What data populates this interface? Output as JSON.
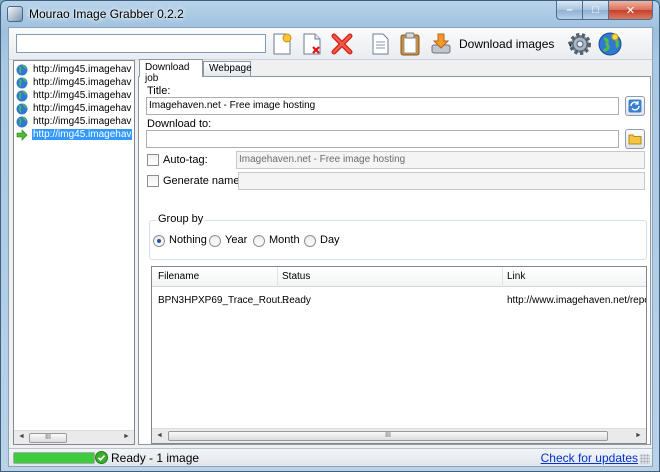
{
  "window": {
    "title": "Mourao Image Grabber 0.2.2",
    "min_glyph": "–",
    "max_glyph": "□",
    "close_glyph": "✕"
  },
  "toolbar": {
    "url_value": "",
    "download_label": "Download images",
    "download_arrow": "▼",
    "icons": [
      "new-job-icon",
      "remove-job-icon",
      "delete-icon",
      "document-icon",
      "clipboard-icon",
      "download-images-icon",
      "settings-gear-icon",
      "globe-icon"
    ]
  },
  "tree": {
    "items": [
      {
        "label": "http://img45.imagehav",
        "icon": "globe-icon",
        "selected": false
      },
      {
        "label": "http://img45.imagehav",
        "icon": "globe-icon",
        "selected": false
      },
      {
        "label": "http://img45.imagehav",
        "icon": "globe-icon",
        "selected": false
      },
      {
        "label": "http://img45.imagehav",
        "icon": "globe-icon",
        "selected": false
      },
      {
        "label": "http://img45.imagehav",
        "icon": "globe-icon",
        "selected": false
      },
      {
        "label": "http://img45.imagehav",
        "icon": "green-arrow-icon",
        "selected": true
      }
    ],
    "scroll_left": "◄",
    "scroll_right": "►",
    "scroll_thumb": "III"
  },
  "tabs": [
    {
      "label": "Download job",
      "active": true
    },
    {
      "label": "Webpage",
      "active": false
    }
  ],
  "form": {
    "title_label": "Title:",
    "title_value": "Imagehaven.net - Free image hosting",
    "download_to_label": "Download to:",
    "download_to_value": "",
    "autotag_label": "Auto-tag:",
    "autotag_value": "Imagehaven.net - Free image hosting",
    "generate_names_label": "Generate names",
    "generate_names_value": "",
    "group_by_label": "Group by",
    "group_by_options": [
      "Nothing",
      "Year",
      "Month",
      "Day"
    ],
    "group_by_selected": "Nothing"
  },
  "files": {
    "columns": [
      "Filename",
      "Status",
      "Link"
    ],
    "rows": [
      [
        "BPN3HPXP69_Trace_Rout...",
        "Ready",
        "http://www.imagehaven.net/report"
      ]
    ],
    "scroll_left": "◄",
    "scroll_right": "►",
    "scroll_thumb": "III"
  },
  "status": {
    "progress": 1.0,
    "text": "Ready - 1 image",
    "update_link": "Check for updates"
  },
  "colors": {
    "accent": "#3399ff",
    "progress": "#3ecb3e",
    "link": "#0033cc"
  }
}
